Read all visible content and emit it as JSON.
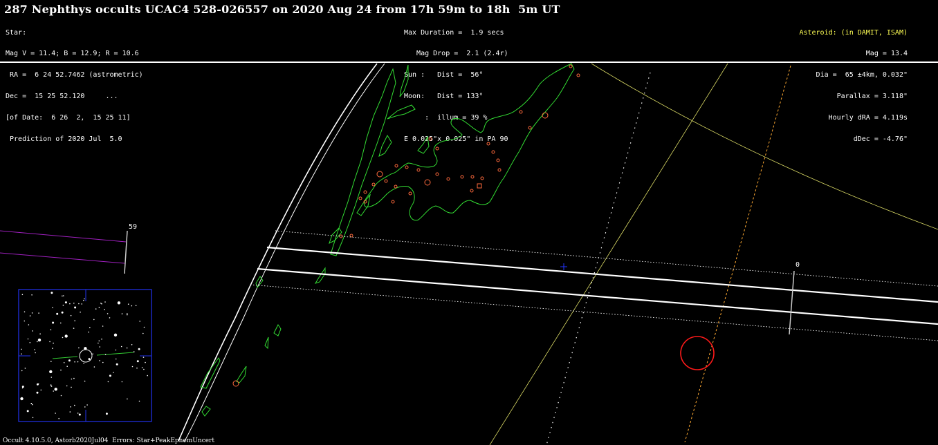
{
  "title": "287 Nephthys occults UCAC4 528-026557 on 2020 Aug 24 from 17h 59m to 18h  5m UT",
  "star_info": [
    "Star:",
    "Mag V = 11.4; B = 12.9; R = 10.6",
    " RA =  6 24 52.7462 (astrometric)",
    "Dec =  15 25 52.120     ...",
    "[of Date:  6 26  2,  15 25 11]",
    " Prediction of 2020 Jul  5.0"
  ],
  "event_info": [
    "Max Duration =  1.9 secs",
    "   Mag Drop =  2.1 (2.4r)",
    "Sun :   Dist =  56°",
    "Moon:   Dist = 133°",
    "     :  illum = 39 %",
    "E 0.025\"x 0.025\" in PA 90"
  ],
  "asteroid_info": {
    "header": "Asteroid: (in DAMIT, ISAM)",
    "lines": [
      "Mag = 13.4",
      "Dia =  65 ±4km, 0.032\"",
      "Parallax = 3.118\"",
      "Hourly dRA = 4.119s",
      "dDec = -4.76\""
    ]
  },
  "time_ticks": {
    "left": "59",
    "right": "0"
  },
  "footer": "Occult 4.10.5.0, Astorb2020Jul04  Errors: Star+PeakEphemUncert",
  "colors": {
    "background": "#000000",
    "path_lines": "#ffffff",
    "coastlines": "#33dd33",
    "cities": "#ff6a3d",
    "grid": "#dddd66",
    "sun_terminator": "#ffaa33",
    "star_circle": "#ff1a1a",
    "finder_frame": "#2233ee",
    "center_cross": "#2233ff",
    "prev_path": "#a020c0"
  }
}
